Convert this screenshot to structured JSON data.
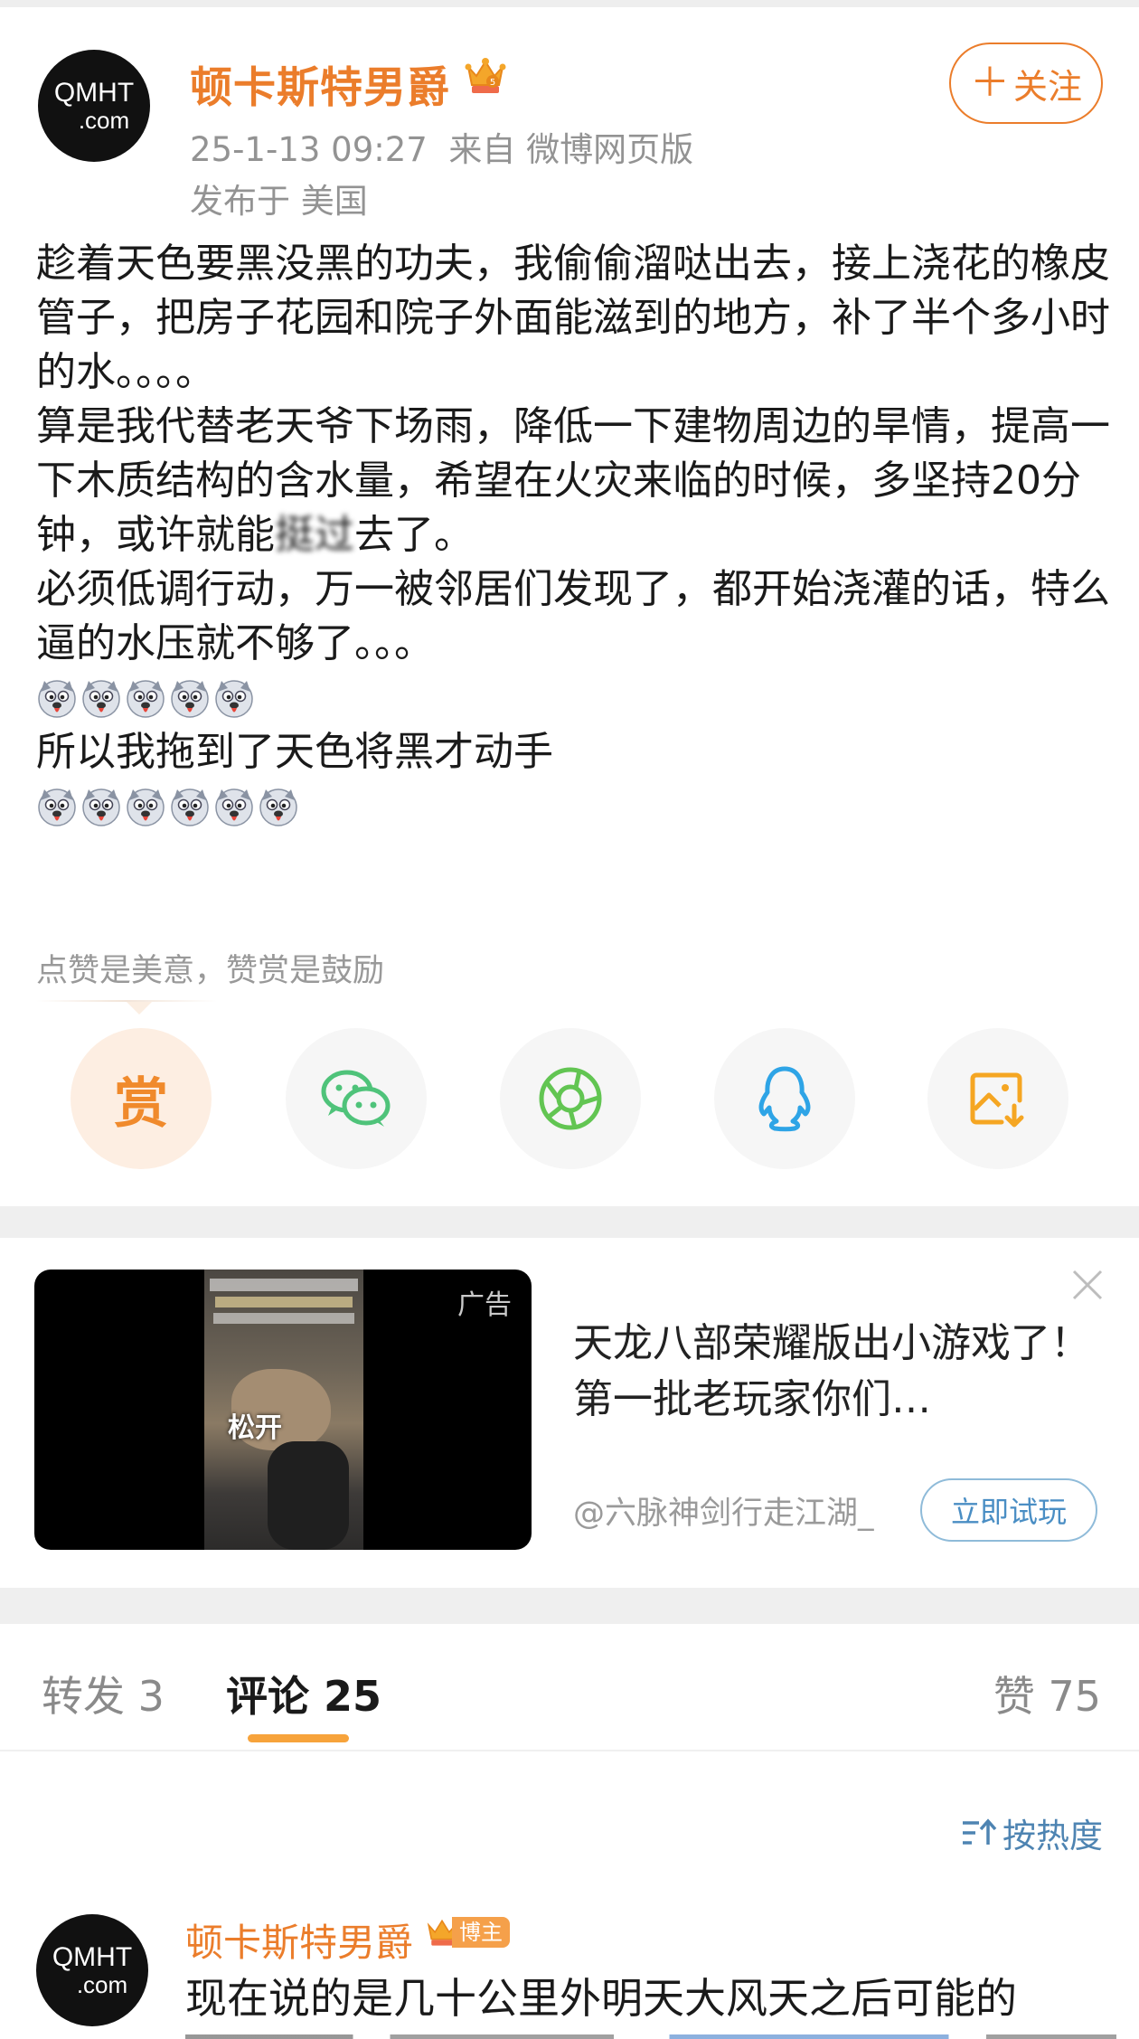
{
  "post": {
    "avatar": {
      "line1": "QMHT",
      "line2": ".com"
    },
    "username": "顿卡斯特男爵",
    "time": "25-1-13 09:27",
    "source": "来自 微博网页版",
    "location": "发布于 美国",
    "follow_label": "关注",
    "follow_icon": "＋",
    "body": {
      "p1": "趁着天色要黑没黑的功夫，我偷偷溜哒出去，接上浇花的橡皮管子，把房子花园和院子外面能滋到的地方，补了半个多小时的水。。。。",
      "p2a": "算是我代替老天爷下场雨，降低一下建物周边的旱情，提高一下木质结构的含水量，希望在火灾来临的时候，多坚持20分钟，或许就能",
      "p2b": "挺过",
      "p2c": "去了。",
      "p3": "必须低调行动，万一被邻居们发现了，都开始浇灌的话，特么逼的水压就不够了。。。",
      "p4": "所以我拖到了天色将黑才动手"
    },
    "emoji_row1_count": 5,
    "emoji_row2_count": 6,
    "emoji_name": "doge-emoji",
    "tip": "点赞是美意，赞赏是鼓励",
    "reward_label": "赏",
    "share_icons": [
      "reward-icon",
      "wechat-icon",
      "moments-icon",
      "qq-icon",
      "save-image-icon"
    ]
  },
  "ad": {
    "label": "广告",
    "video_caption": "松开",
    "title": "天龙八部荣耀版出小游戏了！第一批老玩家你们…",
    "source": "@六脉神剑行走江湖_",
    "cta": "立即试玩"
  },
  "tabs": {
    "repost": "转发 3",
    "comments": "评论 25",
    "likes": "赞 75"
  },
  "sort_label": "按热度",
  "comment": {
    "avatar": {
      "line1": "QMHT",
      "line2": ".com"
    },
    "username": "顿卡斯特男爵",
    "badge": "博主",
    "text": "现在说的是几十公里外明天大风天之后可能的"
  },
  "colors": {
    "brand_orange": "#eb7d2b",
    "link_blue": "#4e84b2",
    "tab_underline": "#f7a33b"
  }
}
